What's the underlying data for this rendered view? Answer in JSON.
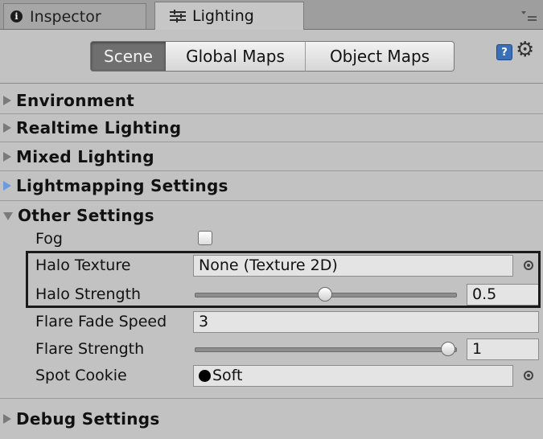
{
  "tabs": {
    "inspector": "Inspector",
    "lighting": "Lighting"
  },
  "toolbar": {
    "scene": "Scene",
    "global_maps": "Global Maps",
    "object_maps": "Object Maps",
    "help_glyph": "?",
    "settings_glyph": "⚙"
  },
  "sections": {
    "environment": "Environment",
    "realtime_lighting": "Realtime Lighting",
    "mixed_lighting": "Mixed Lighting",
    "lightmapping_settings": "Lightmapping Settings",
    "other_settings": "Other Settings",
    "debug_settings": "Debug Settings"
  },
  "other_settings": {
    "fog_label": "Fog",
    "fog_checked": false,
    "halo_texture_label": "Halo Texture",
    "halo_texture_value": "None (Texture 2D)",
    "halo_strength_label": "Halo Strength",
    "halo_strength_value": "0.5",
    "halo_strength_fraction": 0.5,
    "flare_fade_speed_label": "Flare Fade Speed",
    "flare_fade_speed_value": "3",
    "flare_strength_label": "Flare Strength",
    "flare_strength_value": "1",
    "flare_strength_fraction": 1.0,
    "spot_cookie_label": "Spot Cookie",
    "spot_cookie_value": "Soft"
  },
  "colors": {
    "panel_bg": "#c2c2c2",
    "selected_segment": "#6f6f6f",
    "section_arrow_active": "#6d9be0"
  }
}
